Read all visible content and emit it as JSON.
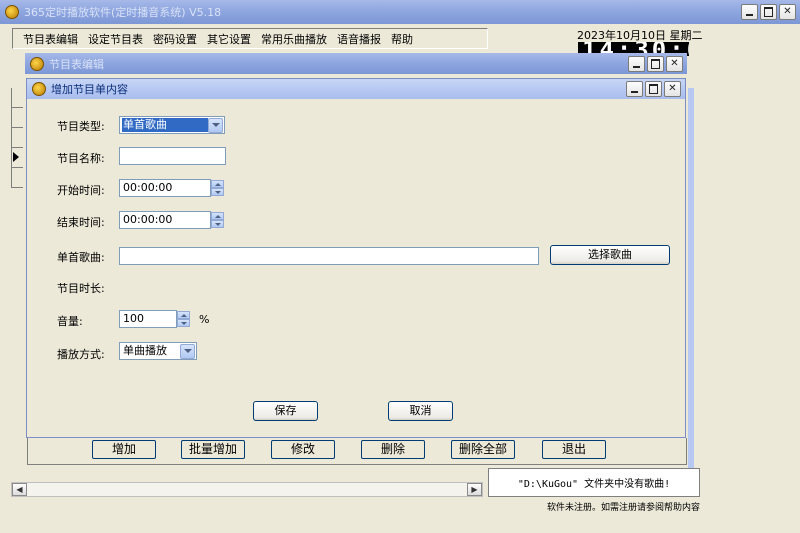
{
  "main_window": {
    "title": "365定时播放软件(定时播音系统) V5.18",
    "menu": [
      "节目表编辑",
      "设定节目表",
      "密码设置",
      "其它设置",
      "常用乐曲播放",
      "语音播报",
      "帮助"
    ],
    "date_label": "2023年10月10日  星期二",
    "clock": "14:30:02"
  },
  "editor_window": {
    "title": "节目表编辑",
    "bottom_buttons": [
      "增加",
      "批量增加",
      "修改",
      "删除",
      "删除全部",
      "退出"
    ],
    "status_message": "\"D:\\KuGou\" 文件夹中没有歌曲!",
    "register_note": "软件未注册。如需注册请参阅帮助内容"
  },
  "dialog": {
    "title": "增加节目单内容",
    "labels": {
      "type": "节目类型:",
      "name": "节目名称:",
      "start": "开始时间:",
      "end": "结束时间:",
      "song": "单首歌曲:",
      "duration": "节目时长:",
      "volume": "音量:",
      "mode": "播放方式:"
    },
    "values": {
      "type": "单首歌曲",
      "name": "",
      "start": "00:00:00",
      "end": "00:00:00",
      "song": "",
      "volume": "100",
      "volume_unit": "%",
      "mode": "单曲播放"
    },
    "buttons": {
      "choose_song": "选择歌曲",
      "save": "保存",
      "cancel": "取消"
    }
  },
  "icons": [
    "app-icon",
    "minimize-icon",
    "maximize-icon",
    "close-icon",
    "dropdown-arrow-icon",
    "spin-up-icon",
    "spin-down-icon",
    "scroll-left-icon",
    "scroll-right-icon"
  ],
  "colors": {
    "title_active": "#0b2e7a",
    "selection": "#316ac5",
    "window_bg": "#ece9d8"
  }
}
